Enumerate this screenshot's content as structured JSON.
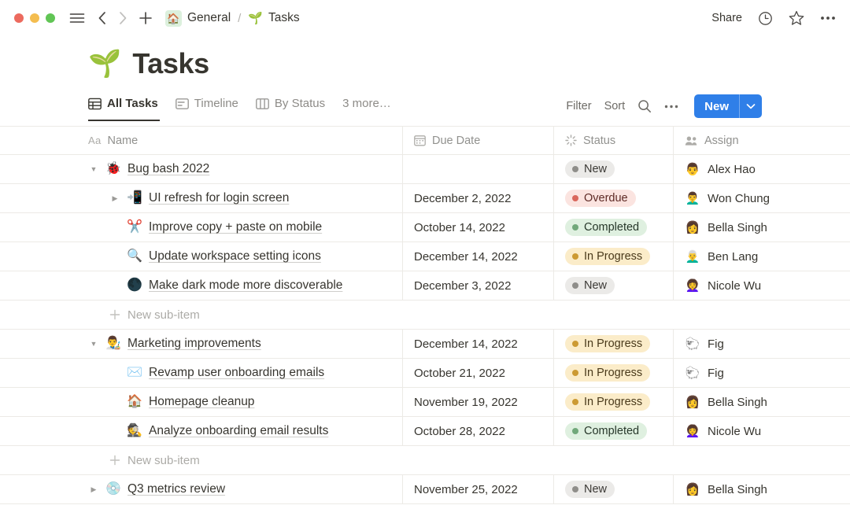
{
  "window": {
    "traffic_lights": [
      "close",
      "minimize",
      "maximize"
    ],
    "breadcrumb": {
      "home_icon": "house-icon",
      "home_label": "General",
      "separator": "/",
      "page_emoji": "🌱",
      "page_label": "Tasks"
    },
    "actions": {
      "share_label": "Share",
      "history_icon": "clock-icon",
      "favorite_icon": "star-icon",
      "more_icon": "ellipsis-icon"
    },
    "nav": {
      "menu_icon": "hamburger-icon",
      "back_icon": "chevron-left-icon",
      "forward_icon": "chevron-right-icon",
      "new_tab_icon": "plus-icon"
    }
  },
  "page": {
    "emoji": "🌱",
    "title": "Tasks"
  },
  "views": {
    "tabs": [
      {
        "label": "All Tasks",
        "icon": "table-icon",
        "active": true
      },
      {
        "label": "Timeline",
        "icon": "timeline-icon",
        "active": false
      },
      {
        "label": "By Status",
        "icon": "board-icon",
        "active": false
      }
    ],
    "more_label": "3 more…",
    "toolbar": {
      "filter_label": "Filter",
      "sort_label": "Sort",
      "search_icon": "search-icon",
      "more_icon": "ellipsis-icon",
      "new_label": "New",
      "new_caret_icon": "chevron-down-icon",
      "new_button_color": "#2f7fe8"
    }
  },
  "table": {
    "columns": [
      {
        "key": "name",
        "label": "Name",
        "icon": "text-aa-icon"
      },
      {
        "key": "date",
        "label": "Due Date",
        "icon": "calendar-icon"
      },
      {
        "key": "status",
        "label": "Status",
        "icon": "loading-spinner-icon"
      },
      {
        "key": "assign",
        "label": "Assign",
        "icon": "people-icon"
      }
    ],
    "status_styles": {
      "New": {
        "bg": "#ebeae8",
        "fg": "#3c3a36",
        "dot": "#8f8e8a"
      },
      "Overdue": {
        "bg": "#fbe4e0",
        "fg": "#5e2a25",
        "dot": "#d9675c"
      },
      "Completed": {
        "bg": "#dff0e0",
        "fg": "#27372a",
        "dot": "#71a87a"
      },
      "In Progress": {
        "bg": "#fbecc9",
        "fg": "#4a3a1b",
        "dot": "#cc9a33"
      }
    },
    "rows": [
      {
        "type": "item",
        "indent": 0,
        "twist": "open",
        "emoji": "🐞",
        "name": "Bug bash 2022",
        "date": "",
        "status": "New",
        "assignee": "Alex Hao",
        "avatar": "👨"
      },
      {
        "type": "item",
        "indent": 1,
        "twist": "closed",
        "emoji": "📲",
        "name": "UI refresh for login screen",
        "date": "December 2, 2022",
        "status": "Overdue",
        "assignee": "Won Chung",
        "avatar": "👨‍🦱"
      },
      {
        "type": "item",
        "indent": 1,
        "twist": "blank",
        "emoji": "✂️",
        "name": "Improve copy + paste on mobile",
        "date": "October 14, 2022",
        "status": "Completed",
        "assignee": "Bella Singh",
        "avatar": "👩"
      },
      {
        "type": "item",
        "indent": 1,
        "twist": "blank",
        "emoji": "🔍",
        "name": "Update workspace setting icons",
        "date": "December 14, 2022",
        "status": "In Progress",
        "assignee": "Ben Lang",
        "avatar": "👨‍🦳"
      },
      {
        "type": "item",
        "indent": 1,
        "twist": "blank",
        "emoji": "🌑",
        "name": "Make dark mode more discoverable",
        "date": "December 3, 2022",
        "status": "New",
        "assignee": "Nicole Wu",
        "avatar": "👩‍🦱"
      },
      {
        "type": "subnew",
        "indent": 1,
        "label": "New sub-item"
      },
      {
        "type": "item",
        "indent": 0,
        "twist": "open",
        "emoji": "👨‍🎨",
        "name": "Marketing improvements",
        "date": "December 14, 2022",
        "status": "In Progress",
        "assignee": "Fig",
        "avatar": "🐑"
      },
      {
        "type": "item",
        "indent": 1,
        "twist": "blank",
        "emoji": "✉️",
        "name": "Revamp user onboarding emails",
        "date": "October 21, 2022",
        "status": "In Progress",
        "assignee": "Fig",
        "avatar": "🐑"
      },
      {
        "type": "item",
        "indent": 1,
        "twist": "blank",
        "emoji": "🏠",
        "name": "Homepage cleanup",
        "date": "November 19, 2022",
        "status": "In Progress",
        "assignee": "Bella Singh",
        "avatar": "👩"
      },
      {
        "type": "item",
        "indent": 1,
        "twist": "blank",
        "emoji": "🕵️",
        "name": "Analyze onboarding email results",
        "date": "October 28, 2022",
        "status": "Completed",
        "assignee": "Nicole Wu",
        "avatar": "👩‍🦱"
      },
      {
        "type": "subnew",
        "indent": 1,
        "label": "New sub-item"
      },
      {
        "type": "item",
        "indent": 0,
        "twist": "closed",
        "emoji": "💿",
        "name": "Q3 metrics review",
        "date": "November 25, 2022",
        "status": "New",
        "assignee": "Bella Singh",
        "avatar": "👩"
      }
    ]
  }
}
